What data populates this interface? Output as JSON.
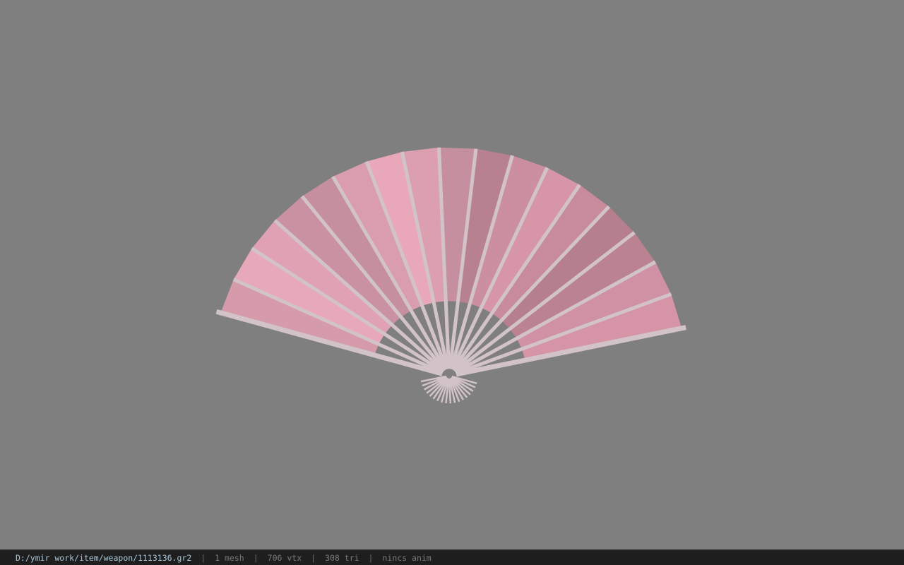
{
  "viewport": {
    "background_color": "#7f7f7f",
    "model": {
      "icon": "folding-fan-icon",
      "paper_color": "#d89aaa",
      "rib_color": "#d2c3c8"
    }
  },
  "status_bar": {
    "file_path": "D:/ymir work/item/weapon/1113136.gr2",
    "separator": "|",
    "mesh_count": "1 mesh",
    "vertex_count": "706 vtx",
    "triangle_count": "308 tri",
    "animation": "nincs anim"
  }
}
